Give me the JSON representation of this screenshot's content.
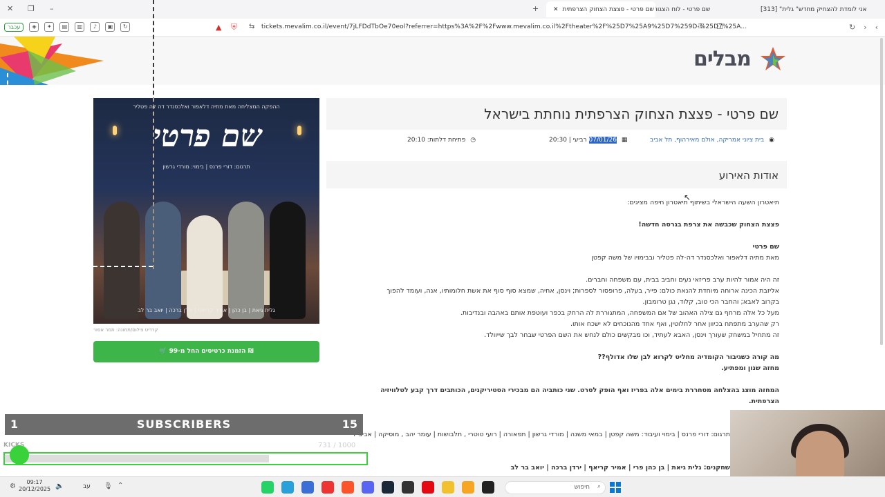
{
  "tabs": [
    {
      "label": "שם פרטי - לוח הצגות 2025 | מבלים",
      "active": false
    },
    {
      "label": "שם פרטי - פצצת הצחוק הצרפתית",
      "active": true
    },
    {
      "label": "[313] \"אני לומדת להצחיק מחדש\" גלית",
      "active": false
    }
  ],
  "browser": {
    "url": "tickets.mevalim.co.il/event/7jLFDdTbOe70eol?referrer=https%3A%2F%2Fwww.mevalim.co.il%2Ftheater%2F%25D7%25A9%25D7%259D-%25D7%25A...",
    "reader_label": "עכבר"
  },
  "site": {
    "logo": "מבלים"
  },
  "event": {
    "title": "שם פרטי - פצצת הצחוק הצרפתית נוחתת בישראל",
    "location": "בית ציוני אמריקה, אולם מאירהוף, תל אביב",
    "date": "07/01/26",
    "day_time": "רביעי | 20:30",
    "doors": "פתיחת דלתות: 20:10",
    "about_title": "אודות האירוע",
    "photo_credit": "קרדיט צילום/תמונה: תמר אסור",
    "buy_button": "הזמנת כרטיסים החל מ-99 ₪"
  },
  "poster": {
    "title": "שם פרטי",
    "top_line": "ההפקה המצליחה מאת מתיה דלאפור ואלכסנדר דה לה פטליר",
    "sub_line": "תרגום: דורי פרנס  |  בימוי: מורדי גרשון",
    "cast_line": "גלית גיאת  |  בן כהן  |  אמיר קריאף  |  ירדן ברכה  |  יואב בר לב"
  },
  "description": [
    {
      "type": "text",
      "text": "תיאטרון השעה הישראלי בשיתוף תיאטרון חיפה מציגים:"
    },
    {
      "type": "gap"
    },
    {
      "type": "bold",
      "text": "פצצת הצחוק שכבשה את צרפת בגרסה חדשה!"
    },
    {
      "type": "gap"
    },
    {
      "type": "bold",
      "text": "שם פרטי"
    },
    {
      "type": "text",
      "text": "מאת מתיה דלאפור ואלכסנדר דה-לה פטליר ובבימויו של משה קפטן"
    },
    {
      "type": "gap"
    },
    {
      "type": "text",
      "text": "זה היה אמור להיות ערב פריזאי נעים וחביב בבית, עם משפחה וחברים."
    },
    {
      "type": "text",
      "text": "אליזבת הכינה ארוחה מיוחדת להנאת כולם: פייר, בעלה, פרופסור לספרות; וינסן, אחיה, שמצא סוף סוף את אשת חלומותיו, אנה, ועומד להפוך"
    },
    {
      "type": "text",
      "text": "בקרוב לאבא; והחבר הכי טוב, קלוד, נגן טרומבון."
    },
    {
      "type": "text",
      "text": "מעל כל אלה מרחף גם צילה האהוב של אם המשפחה, המתגוררת לה הרחק בכפר ועוטפת אותם באהבה ובנדיבות."
    },
    {
      "type": "text",
      "text": "רק שהערב מתפתח בכיוון אחר לחלוטין, ואף אחד מהנוכחים לא ישכח אותו."
    },
    {
      "type": "text",
      "text": "זה מתחיל במשחק שעורך וינסן, האבא לעתיד, וכו מבקשים כולם לנחש את השם הפרטי שבחר לבך שייוולד."
    },
    {
      "type": "gap"
    },
    {
      "type": "bold",
      "text": "מה קורה כשגיבור הקומדיה מחליט לקרוא לבן שלו אדולף??"
    },
    {
      "type": "bold",
      "text": "מחזה שנון ומפתיע."
    },
    {
      "type": "gap"
    },
    {
      "type": "bold",
      "text": "המחזה מוצג בהצלחה מסחררת בימים אלה בפריז ואף הופק לסרט. שני כותביה הם מבכירי הסטיריקנים, הכותבים דרך קבע לטלוויזיה"
    },
    {
      "type": "bold",
      "text": "הצרפתית."
    }
  ],
  "credits_line": "תרגום: דורי פרנס | בימוי ועיבוד: משה קפטן | במאי משנה | מורדי גרשון | תפאורה | רועי טוטרי , תלבושות | עומר יהב , מוסיקה | אביב קורן , תאורה | מתן פרמינגר",
  "cast_credits": "שחקנים: גלית גיאת | בן כהן פרי | אמיר קריאף | ירדן ברכה | יואב בר לב",
  "stream": {
    "sub_count_left": "1",
    "label": "SUBSCRIBERS",
    "sub_count_right": "15",
    "kicks_label": "KICKS",
    "kicks_progress": "731 / 1000",
    "kicks_fraction": 0.731
  },
  "taskbar": {
    "time": "09:17",
    "date": "20/12/2025",
    "lang": "עב",
    "search_placeholder": "חיפוש"
  },
  "colors": {
    "accent_green": "#3db549",
    "link_blue": "#3a6fb0",
    "selection": "#2d66c8"
  }
}
